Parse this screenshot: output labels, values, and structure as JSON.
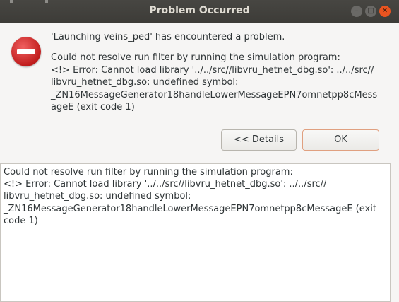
{
  "window": {
    "title": "Problem Occurred",
    "controls": {
      "minimize_icon": "minimize-icon",
      "maximize_icon": "maximize-icon",
      "close_icon": "close-icon",
      "close_color": "#e95420"
    }
  },
  "message": {
    "icon": "error-icon",
    "title": "'Launching veins_ped' has encountered a problem.",
    "lines": [
      "Could not resolve run filter by running the simulation program:",
      "<!> Error: Cannot load library '../../src//libvru_hetnet_dbg.so': ../../src//",
      "libvru_hetnet_dbg.so: undefined symbol:",
      "_ZN16MessageGenerator18handleLowerMessageEPN7omnetpp8cMess",
      "ageE (exit code 1)"
    ]
  },
  "buttons": {
    "details_label": "<< Details",
    "ok_label": "OK"
  },
  "details": {
    "lines": [
      "Could not resolve run filter by running the simulation program:",
      "<!> Error: Cannot load library '../../src//libvru_hetnet_dbg.so': ../../src//",
      "libvru_hetnet_dbg.so: undefined symbol:",
      "_ZN16MessageGenerator18handleLowerMessageEPN7omnetpp8cMessageE (exit",
      "code 1)"
    ]
  }
}
